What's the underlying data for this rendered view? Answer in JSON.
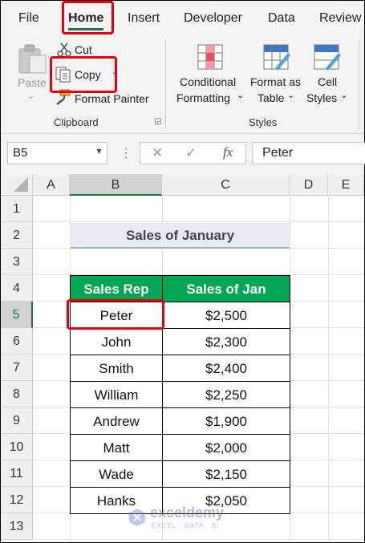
{
  "menu": {
    "tabs": [
      "File",
      "Home",
      "Insert",
      "Developer",
      "Data",
      "Review"
    ],
    "active": "Home"
  },
  "ribbon": {
    "clipboard": {
      "paste_label": "Paste",
      "cut_label": "Cut",
      "copy_label": "Copy",
      "format_painter_label": "Format Painter",
      "group_label": "Clipboard"
    },
    "styles": {
      "conditional_line1": "Conditional",
      "conditional_line2": "Formatting",
      "format_table_line1": "Format as",
      "format_table_line2": "Table",
      "cell_styles_line1": "Cell",
      "cell_styles_line2": "Styles",
      "group_label": "Styles"
    }
  },
  "formula_bar": {
    "name_box": "B5",
    "fx": "fx",
    "value": "Peter"
  },
  "columns": [
    "A",
    "B",
    "C",
    "D",
    "E"
  ],
  "rows": [
    "1",
    "2",
    "3",
    "4",
    "5",
    "6",
    "7",
    "8",
    "9",
    "10",
    "11",
    "12",
    "13"
  ],
  "sheet": {
    "title": "Sales of January",
    "headers": [
      "Sales Rep",
      "Sales of Jan"
    ],
    "records": [
      [
        "Peter",
        "$2,500"
      ],
      [
        "John",
        "$2,300"
      ],
      [
        "Smith",
        "$2,400"
      ],
      [
        "William",
        "$2,250"
      ],
      [
        "Andrew",
        "$1,900"
      ],
      [
        "Matt",
        "$2,000"
      ],
      [
        "Wade",
        "$2,150"
      ],
      [
        "Hanks",
        "$2,050"
      ]
    ]
  },
  "watermark": {
    "brand": "exceldemy",
    "tagline": "EXCEL · DATA · BI"
  },
  "colors": {
    "excel_green": "#217346",
    "header_green": "#00a651",
    "highlight_red": "#e3000f"
  }
}
